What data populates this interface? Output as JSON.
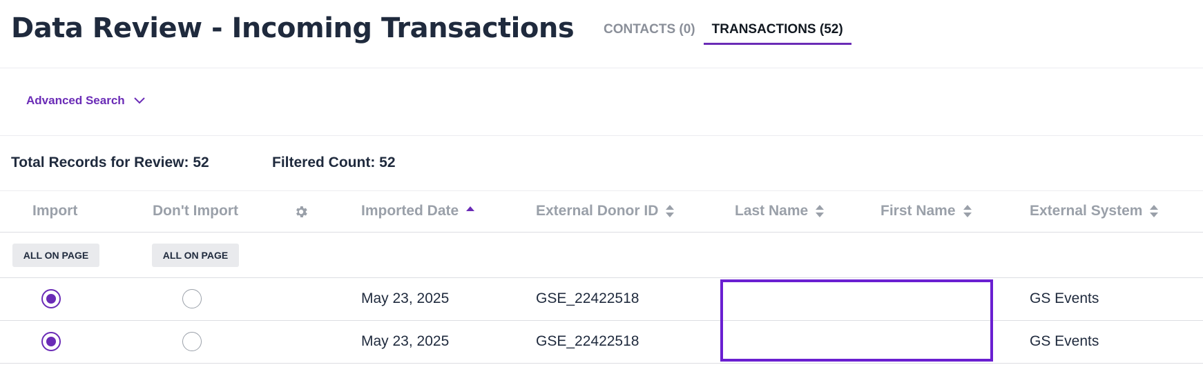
{
  "header": {
    "title": "Data Review - Incoming Transactions",
    "tabs": [
      {
        "label": "CONTACTS (0)",
        "active": false
      },
      {
        "label": "TRANSACTIONS (52)",
        "active": true
      }
    ]
  },
  "search": {
    "advanced_label": "Advanced Search",
    "icon": "chevron-down-icon"
  },
  "summary": {
    "total_label": "Total Records for Review: 52",
    "filtered_label": "Filtered Count: 52"
  },
  "table": {
    "columns": {
      "import": "Import",
      "dont_import": "Don't Import",
      "settings_icon": "gear-icon",
      "imported_date": "Imported Date",
      "external_donor_id": "External Donor ID",
      "last_name": "Last Name",
      "first_name": "First Name",
      "external_system": "External System"
    },
    "bulk": {
      "import_all": "ALL ON PAGE",
      "dont_import_all": "ALL ON PAGE"
    },
    "rows": [
      {
        "import": true,
        "imported_date": "May 23, 2025",
        "external_donor_id": "GSE_22422518",
        "last_name": "",
        "first_name": "",
        "external_system": "GS Events"
      },
      {
        "import": true,
        "imported_date": "May 23, 2025",
        "external_donor_id": "GSE_22422518",
        "last_name": "",
        "first_name": "",
        "external_system": "GS Events"
      }
    ]
  },
  "colors": {
    "accent": "#6a2bb6",
    "highlight": "#6a1fd1",
    "text": "#1f2a3d",
    "muted": "#9aa0a9"
  }
}
